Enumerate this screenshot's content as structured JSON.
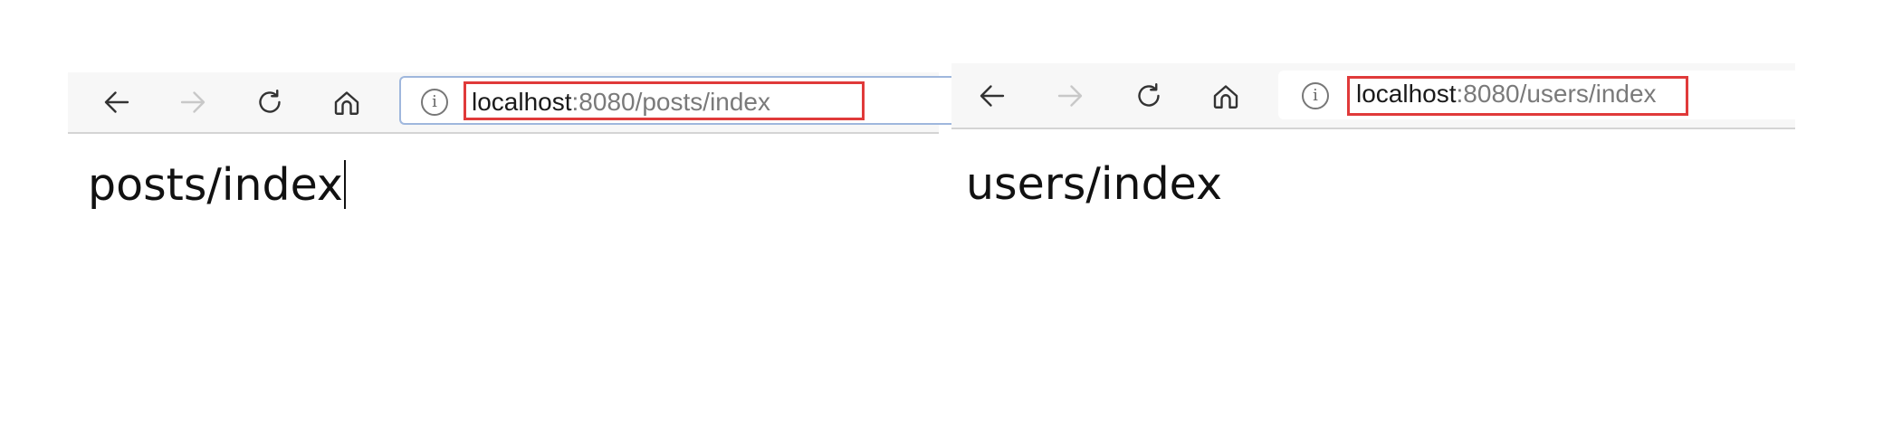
{
  "left_window": {
    "url_host": "localhost",
    "url_path": ":8080/posts/index",
    "page_text": "posts/index",
    "buttons": {
      "back_icon": "arrow-left-icon",
      "forward_icon": "arrow-right-icon",
      "refresh_icon": "refresh-icon",
      "home_icon": "home-icon",
      "info_icon": "i"
    }
  },
  "right_window": {
    "url_host": "localhost",
    "url_path": ":8080/users/index",
    "page_text": "users/index",
    "buttons": {
      "back_icon": "arrow-left-icon",
      "forward_icon": "arrow-right-icon",
      "refresh_icon": "refresh-icon",
      "home_icon": "home-icon",
      "info_icon": "i"
    }
  },
  "colors": {
    "highlight": "#e03a3a",
    "url_host": "#1a1a1a",
    "url_path": "#7a7a7a",
    "disabled_icon": "#c8c8c8"
  }
}
